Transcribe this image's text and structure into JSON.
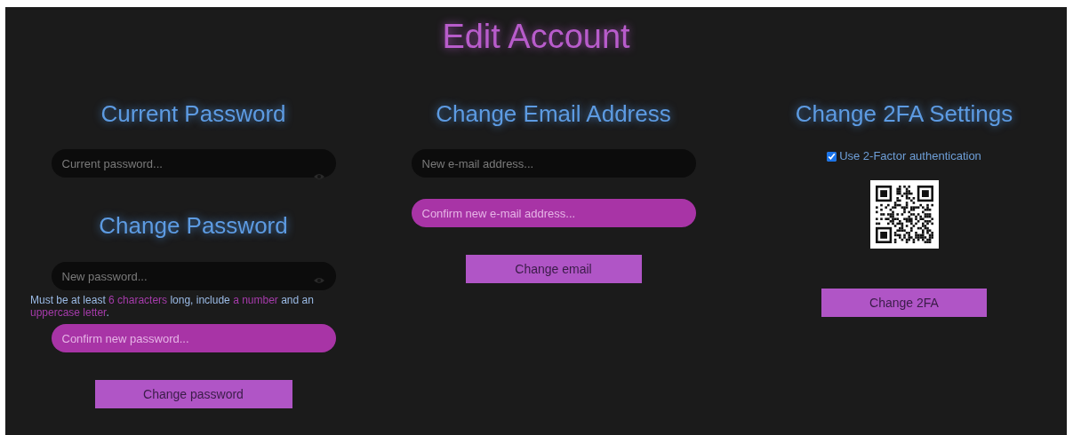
{
  "title": "Edit Account",
  "columns": [
    {
      "sections": [
        {
          "heading": "Current Password",
          "items": [
            {
              "kind": "field",
              "placeholder": "Current password...",
              "reveal_toggle": true
            }
          ]
        },
        {
          "heading": "Change Password",
          "items": [
            {
              "kind": "field",
              "placeholder": "New password...",
              "reveal_toggle": true
            },
            {
              "kind": "hint",
              "segments": [
                {
                  "text": "Must be at least ",
                  "highlight": false
                },
                {
                  "text": "6 characters",
                  "highlight": true
                },
                {
                  "text": " long, include ",
                  "highlight": false
                },
                {
                  "text": "a number",
                  "highlight": true
                },
                {
                  "text": " and an ",
                  "highlight": false
                },
                {
                  "text": "uppercase letter",
                  "highlight": true
                },
                {
                  "text": ".",
                  "highlight": false
                }
              ]
            },
            {
              "kind": "confirm_field",
              "placeholder": "Confirm new password..."
            },
            {
              "kind": "button",
              "label": "Change password"
            }
          ]
        }
      ]
    },
    {
      "sections": [
        {
          "heading": "Change Email Address",
          "items": [
            {
              "kind": "field",
              "placeholder": "New e-mail address..."
            },
            {
              "kind": "confirm_field",
              "placeholder": "Confirm new e-mail address..."
            },
            {
              "kind": "button",
              "label": "Change email"
            }
          ]
        }
      ]
    },
    {
      "sections": [
        {
          "heading": "Change 2FA Settings",
          "items": [
            {
              "kind": "checkbox",
              "label": "Use 2-Factor authentication",
              "checked": true
            },
            {
              "kind": "qr"
            },
            {
              "kind": "button",
              "label": "Change 2FA"
            }
          ]
        }
      ]
    }
  ]
}
